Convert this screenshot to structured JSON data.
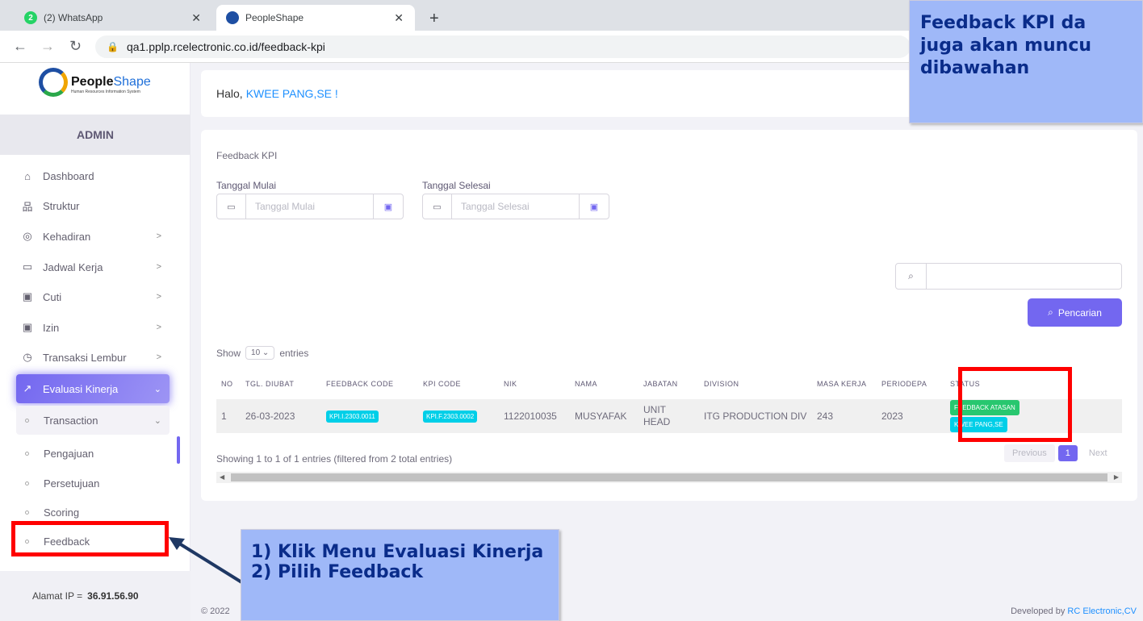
{
  "browser": {
    "tabs": [
      {
        "title": "(2) WhatsApp",
        "badge": "2"
      },
      {
        "title": "PeopleShape"
      }
    ],
    "url": "qa1.pplp.rcelectronic.co.id/feedback-kpi"
  },
  "sidebar": {
    "logo_text": "People",
    "logo_text2": "Shape",
    "logo_sub": "Human Resources Information System",
    "role": "ADMIN",
    "items": [
      {
        "label": "Dashboard",
        "icon": "home-icon"
      },
      {
        "label": "Struktur",
        "icon": "org-chart-icon"
      },
      {
        "label": "Kehadiran",
        "icon": "fingerprint-icon"
      },
      {
        "label": "Jadwal Kerja",
        "icon": "briefcase-icon"
      },
      {
        "label": "Cuti",
        "icon": "calendar-icon"
      },
      {
        "label": "Izin",
        "icon": "calendar-icon"
      },
      {
        "label": "Transaksi Lembur",
        "icon": "clock-icon"
      },
      {
        "label": "Evaluasi Kinerja",
        "icon": "trend-icon"
      }
    ],
    "submenu": {
      "group": "Transaction",
      "items": [
        "Pengajuan",
        "Persetujuan",
        "Scoring",
        "Feedback"
      ]
    },
    "ip_label": "Alamat IP  =",
    "ip_value": "36.91.56.90"
  },
  "header": {
    "greeting": "Halo,",
    "user": "KWEE PANG,SE !"
  },
  "card": {
    "title": "Feedback KPI",
    "start_label": "Tanggal Mulai",
    "start_placeholder": "Tanggal Mulai",
    "end_label": "Tanggal Selesai",
    "end_placeholder": "Tanggal Selesai",
    "search_button": "Pencarian",
    "show_label": "Show",
    "show_value": "10",
    "entries_label": "entries",
    "columns": [
      "NO",
      "TGL. DIUBAT",
      "FEEDBACK CODE",
      "KPI CODE",
      "NIK",
      "NAMA",
      "JABATAN",
      "DIVISION",
      "MASA KERJA",
      "PERIODEPA",
      "STATUS"
    ],
    "rows": [
      {
        "no": "1",
        "tgl": "26-03-2023",
        "feedback_code": "KPI.I.2303.0011",
        "kpi_code": "KPI.F.2303.0002",
        "nik": "1122010035",
        "nama": "MUSYAFAK",
        "jabatan": "UNIT HEAD",
        "division": "ITG PRODUCTION DIV",
        "masa_kerja": "243",
        "periode": "2023",
        "status1": "FEEDBACK ATASAN",
        "status2": "KWEE PANG,SE"
      }
    ],
    "info": "Showing 1 to 1 of 1 entries (filtered from 2 total entries)",
    "pagination": {
      "prev": "Previous",
      "current": "1",
      "next": "Next"
    }
  },
  "footer": {
    "copyright": "© 2022",
    "developed": "Developed by",
    "company": "RC Electronic,CV"
  },
  "annotations": {
    "callout1": [
      "1) Klik Menu Evaluasi Kinerja",
      "2) Pilih Feedback"
    ],
    "callout2": [
      "Feedback KPI da",
      "juga akan muncu",
      "dibawahan"
    ]
  }
}
